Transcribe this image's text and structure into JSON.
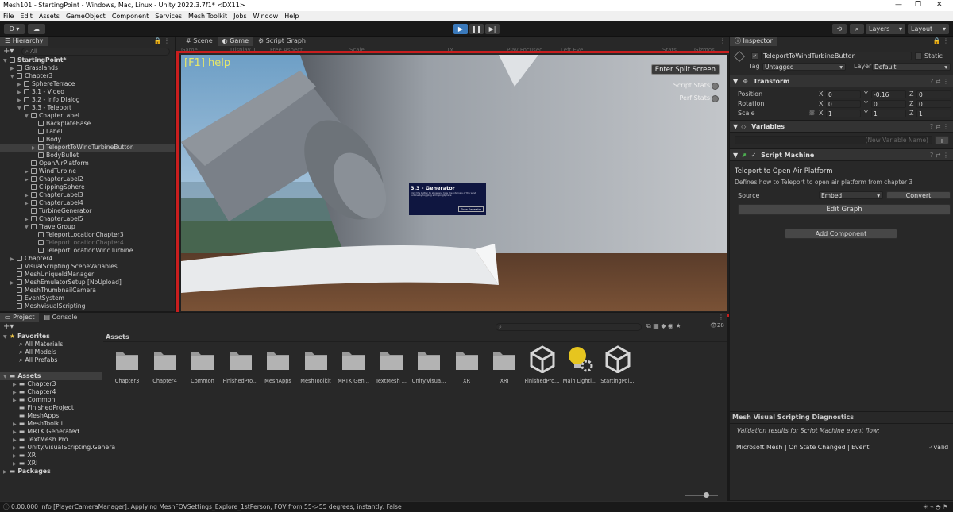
{
  "titlebar": {
    "text": "Mesh101 - StartingPoint - Windows, Mac, Linux - Unity 2022.3.7f1* <DX11>"
  },
  "menu": [
    "File",
    "Edit",
    "Assets",
    "GameObject",
    "Component",
    "Services",
    "Mesh Toolkit",
    "Jobs",
    "Window",
    "Help"
  ],
  "toolbar": {
    "account": "D",
    "layers": "Layers",
    "layout": "Layout"
  },
  "hierarchy": {
    "tab": "Hierarchy",
    "search_placeholder": "All",
    "items": [
      {
        "label": "StartingPoint*",
        "indent": 0,
        "arrow": "▼",
        "bold": true
      },
      {
        "label": "Grasslands",
        "indent": 1,
        "arrow": "▶"
      },
      {
        "label": "Chapter3",
        "indent": 1,
        "arrow": "▼"
      },
      {
        "label": "SphereTerrace",
        "indent": 2,
        "arrow": "▶"
      },
      {
        "label": "3.1 - Video",
        "indent": 2,
        "arrow": "▶"
      },
      {
        "label": "3.2 - Info Dialog",
        "indent": 2,
        "arrow": "▶"
      },
      {
        "label": "3.3 - Teleport",
        "indent": 2,
        "arrow": "▼"
      },
      {
        "label": "ChapterLabel",
        "indent": 3,
        "arrow": "▼"
      },
      {
        "label": "BackplateBase",
        "indent": 4,
        "arrow": ""
      },
      {
        "label": "Label",
        "indent": 4,
        "arrow": ""
      },
      {
        "label": "Body",
        "indent": 4,
        "arrow": ""
      },
      {
        "label": "TeleportToWindTurbineButton",
        "indent": 4,
        "arrow": "▶",
        "selected": true
      },
      {
        "label": "BodyBullet",
        "indent": 4,
        "arrow": ""
      },
      {
        "label": "OpenAirPlatform",
        "indent": 3,
        "arrow": ""
      },
      {
        "label": "WindTurbine",
        "indent": 3,
        "arrow": "▶"
      },
      {
        "label": "ChapterLabel2",
        "indent": 3,
        "arrow": "▶"
      },
      {
        "label": "ClippingSphere",
        "indent": 3,
        "arrow": ""
      },
      {
        "label": "ChapterLabel3",
        "indent": 3,
        "arrow": "▶"
      },
      {
        "label": "ChapterLabel4",
        "indent": 3,
        "arrow": "▶"
      },
      {
        "label": "TurbineGenerator",
        "indent": 3,
        "arrow": ""
      },
      {
        "label": "ChapterLabel5",
        "indent": 3,
        "arrow": "▶"
      },
      {
        "label": "TravelGroup",
        "indent": 3,
        "arrow": "▼"
      },
      {
        "label": "TeleportLocationChapter3",
        "indent": 4,
        "arrow": ""
      },
      {
        "label": "TeleportLocationChapter4",
        "indent": 4,
        "arrow": "",
        "dim": true
      },
      {
        "label": "TeleportLocationWindTurbine",
        "indent": 4,
        "arrow": ""
      },
      {
        "label": "Chapter4",
        "indent": 1,
        "arrow": "▶"
      },
      {
        "label": "VisualScripting SceneVariables",
        "indent": 1,
        "arrow": ""
      },
      {
        "label": "MeshUniqueIdManager",
        "indent": 1,
        "arrow": ""
      },
      {
        "label": "MeshEmulatorSetup [NoUpload]",
        "indent": 1,
        "arrow": "▶"
      },
      {
        "label": "MeshThumbnailCamera",
        "indent": 1,
        "arrow": ""
      },
      {
        "label": "EventSystem",
        "indent": 1,
        "arrow": ""
      },
      {
        "label": "MeshVisualScripting",
        "indent": 1,
        "arrow": ""
      }
    ]
  },
  "center": {
    "tabs": [
      "Scene",
      "Game",
      "Script Graph"
    ],
    "active_tab": "Game",
    "game_toolbar": [
      "Game",
      "Display 1",
      "Free Aspect",
      "Scale",
      "1x",
      "Play Focused",
      "Left Eye",
      "Stats",
      "Gizmos"
    ],
    "help_text": "[F1] help",
    "split_button": "Enter Split Screen",
    "script_stats": "Script Stats",
    "perf_stats": "Perf Stats",
    "panel_title": "3.3 - Generator",
    "panel_body": "Click the button to show and hide the internals of the wind turbine by toggling a ClippingSphere",
    "panel_button": "Show Generator"
  },
  "inspector": {
    "tab": "Inspector",
    "object_name": "TeleportToWindTurbineButton",
    "static_label": "Static",
    "tag_label": "Tag",
    "tag_value": "Untagged",
    "layer_label": "Layer",
    "layer_value": "Default",
    "transform": {
      "title": "Transform",
      "position": {
        "label": "Position",
        "x": "0",
        "y": "-0.16",
        "z": "0"
      },
      "rotation": {
        "label": "Rotation",
        "x": "0",
        "y": "0",
        "z": "0"
      },
      "scale": {
        "label": "Scale",
        "x": "1",
        "y": "1",
        "z": "1"
      }
    },
    "variables": {
      "title": "Variables",
      "placeholder": "(New Variable Name)"
    },
    "script_machine": {
      "title": "Script Machine",
      "graph_title": "Teleport to Open Air Platform",
      "graph_desc": "Defines how to Teleport to open air platform from chapter 3",
      "source_label": "Source",
      "source_value": "Embed",
      "convert_label": "Convert",
      "edit_graph": "Edit Graph"
    },
    "add_component": "Add Component",
    "diagnostics": {
      "title": "Mesh Visual Scripting Diagnostics",
      "subtitle": "Validation results for Script Machine event flow:",
      "event": "Microsoft Mesh | On State Changed | Event",
      "result": "valid"
    }
  },
  "project": {
    "tabs": [
      "Project",
      "Console"
    ],
    "tree": [
      {
        "label": "Favorites",
        "indent": 0,
        "arrow": "▼",
        "bold": true
      },
      {
        "label": "All Materials",
        "indent": 1,
        "arrow": ""
      },
      {
        "label": "All Models",
        "indent": 1,
        "arrow": ""
      },
      {
        "label": "All Prefabs",
        "indent": 1,
        "arrow": ""
      },
      {
        "label": "",
        "indent": 0,
        "arrow": ""
      },
      {
        "label": "Assets",
        "indent": 0,
        "arrow": "▼",
        "bold": true,
        "selected": true
      },
      {
        "label": "Chapter3",
        "indent": 1,
        "arrow": "▶"
      },
      {
        "label": "Chapter4",
        "indent": 1,
        "arrow": "▶"
      },
      {
        "label": "Common",
        "indent": 1,
        "arrow": "▶"
      },
      {
        "label": "FinishedProject",
        "indent": 1,
        "arrow": ""
      },
      {
        "label": "MeshApps",
        "indent": 1,
        "arrow": ""
      },
      {
        "label": "MeshToolkit",
        "indent": 1,
        "arrow": "▶"
      },
      {
        "label": "MRTK.Generated",
        "indent": 1,
        "arrow": "▶"
      },
      {
        "label": "TextMesh Pro",
        "indent": 1,
        "arrow": "▶"
      },
      {
        "label": "Unity.VisualScripting.Genera",
        "indent": 1,
        "arrow": "▶"
      },
      {
        "label": "XR",
        "indent": 1,
        "arrow": "▶"
      },
      {
        "label": "XRI",
        "indent": 1,
        "arrow": "▶"
      },
      {
        "label": "Packages",
        "indent": 0,
        "arrow": "▶",
        "bold": true
      }
    ],
    "breadcrumb": "Assets",
    "count": "28",
    "assets": [
      {
        "label": "Chapter3",
        "kind": "folder"
      },
      {
        "label": "Chapter4",
        "kind": "folder"
      },
      {
        "label": "Common",
        "kind": "folder"
      },
      {
        "label": "FinishedPro...",
        "kind": "folder"
      },
      {
        "label": "MeshApps",
        "kind": "folder"
      },
      {
        "label": "MeshToolkit",
        "kind": "folder"
      },
      {
        "label": "MRTK.Gen...",
        "kind": "folder"
      },
      {
        "label": "TextMesh ...",
        "kind": "folder"
      },
      {
        "label": "Unity.Visua...",
        "kind": "folder"
      },
      {
        "label": "XR",
        "kind": "folder"
      },
      {
        "label": "XRI",
        "kind": "folder"
      },
      {
        "label": "FinishedPro...",
        "kind": "unity"
      },
      {
        "label": "Main Lighti...",
        "kind": "lighting"
      },
      {
        "label": "StartingPoi...",
        "kind": "unity"
      }
    ]
  },
  "status": {
    "text": "0:00.000 Info [PlayerCameraManager]: Applying MeshFOVSettings_Explore_1stPerson, FOV from 55->55 degrees, instantly: False"
  }
}
